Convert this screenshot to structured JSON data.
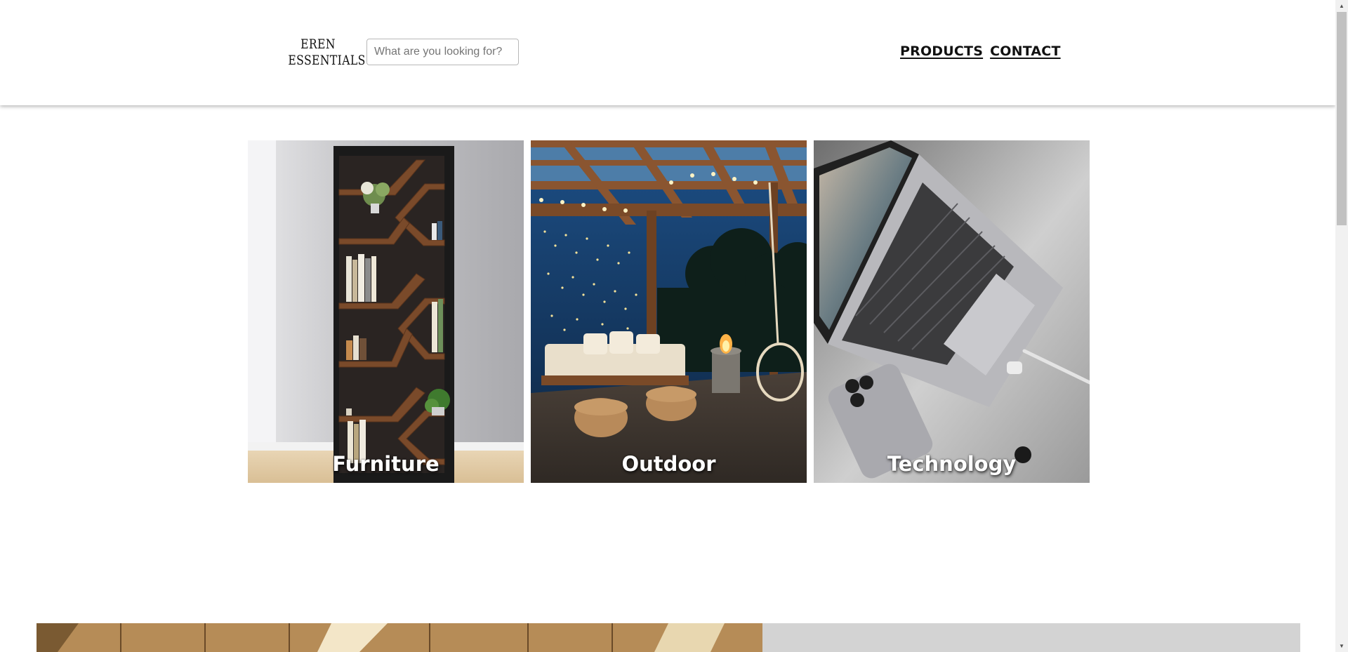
{
  "header": {
    "logo_line1": "EREN",
    "logo_line2": "ESSENTIALS",
    "search_placeholder": "What are you looking for?",
    "nav": {
      "products": "PRODUCTS",
      "contact": "CONTACT"
    }
  },
  "categories": [
    {
      "label": "Furniture",
      "image": "bookshelf-photo"
    },
    {
      "label": "Outdoor",
      "image": "patio-pergola-photo"
    },
    {
      "label": "Technology",
      "image": "laptop-phone-photo"
    }
  ],
  "banner": {
    "image": "warehouse-ceiling-photo",
    "panel_color": "#d3d3d3"
  },
  "colors": {
    "text": "#111111",
    "header_bg": "#ffffff",
    "label_text": "#ffffff"
  }
}
